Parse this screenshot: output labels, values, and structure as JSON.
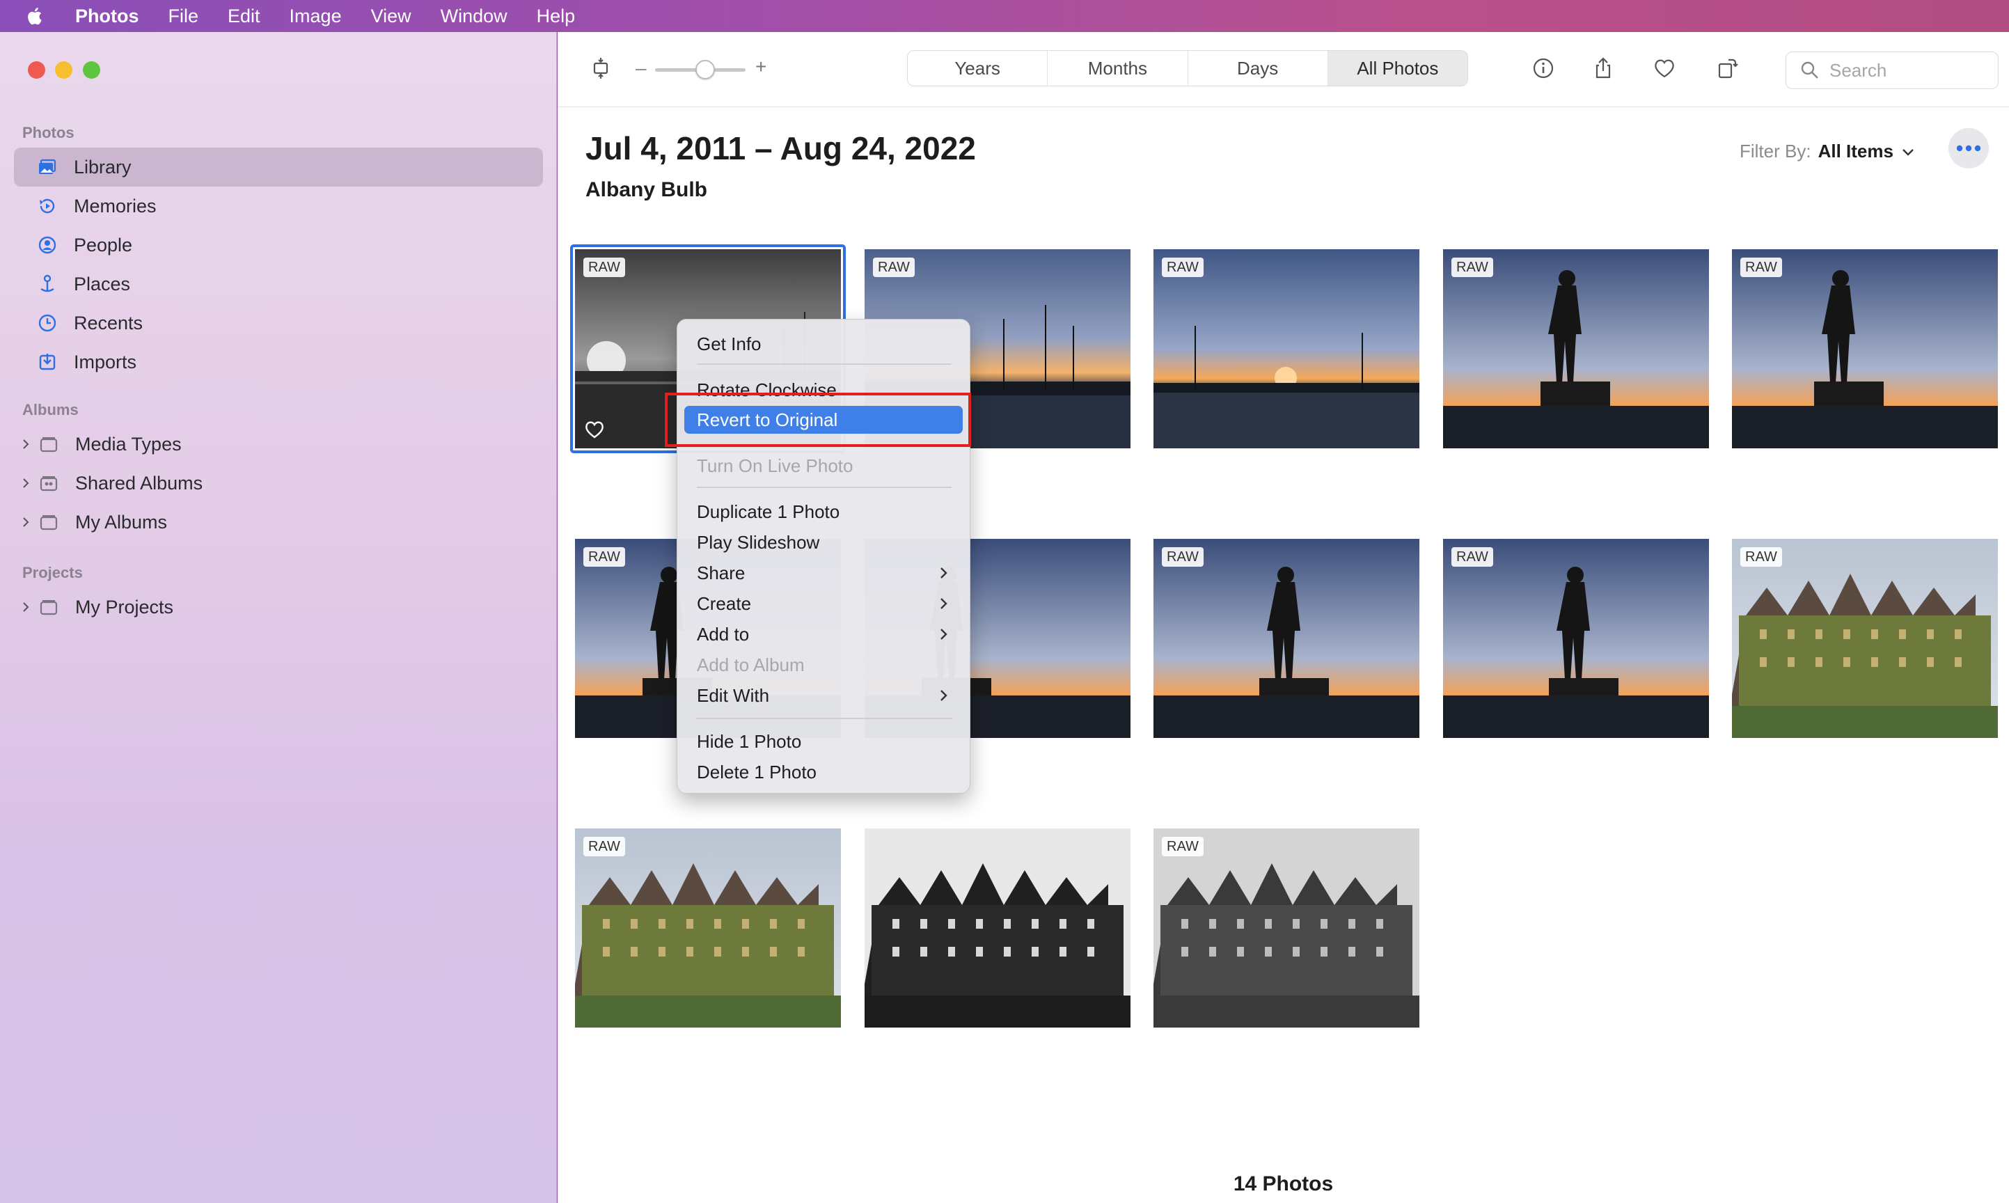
{
  "menubar": {
    "app": "Photos",
    "items": [
      "File",
      "Edit",
      "Image",
      "View",
      "Window",
      "Help"
    ]
  },
  "sidebar": {
    "sections": {
      "photos": "Photos",
      "albums": "Albums",
      "projects": "Projects"
    },
    "photos_items": [
      {
        "label": "Library",
        "icon": "library-icon",
        "selected": true
      },
      {
        "label": "Memories",
        "icon": "memories-icon"
      },
      {
        "label": "People",
        "icon": "people-icon"
      },
      {
        "label": "Places",
        "icon": "places-icon"
      },
      {
        "label": "Recents",
        "icon": "recents-icon"
      },
      {
        "label": "Imports",
        "icon": "imports-icon"
      }
    ],
    "album_items": [
      {
        "label": "Media Types",
        "icon": "folder-icon"
      },
      {
        "label": "Shared Albums",
        "icon": "shared-folder-icon"
      },
      {
        "label": "My Albums",
        "icon": "folder-icon"
      }
    ],
    "project_items": [
      {
        "label": "My Projects",
        "icon": "folder-icon"
      }
    ]
  },
  "toolbar": {
    "zoom_minus": "–",
    "zoom_plus": "+",
    "zoom_level": 0.55,
    "segments": [
      "Years",
      "Months",
      "Days",
      "All Photos"
    ],
    "active_segment": "All Photos",
    "search_placeholder": "Search"
  },
  "header": {
    "title": "Jul 4, 2011 – Aug 24, 2022",
    "subtitle": "Albany Bulb",
    "filter_label": "Filter By:",
    "filter_value": "All Items"
  },
  "photos": {
    "badge": "RAW",
    "count_label": "14 Photos",
    "tiles": [
      {
        "scene": "sunset-harbor-bw",
        "favorite": true,
        "selected": true
      },
      {
        "scene": "sunset-harbor"
      },
      {
        "scene": "sunset-harbor"
      },
      {
        "scene": "statue-silhouette"
      },
      {
        "scene": "statue-silhouette"
      },
      {
        "scene": "statue-silhouette"
      },
      {
        "scene": "statue-silhouette"
      },
      {
        "scene": "statue-silhouette"
      },
      {
        "scene": "statue-silhouette"
      },
      {
        "scene": "empress-hotel"
      },
      {
        "scene": "empress-hotel"
      },
      {
        "scene": "empress-hotel-bw"
      },
      {
        "scene": "empress-hotel-bw"
      }
    ]
  },
  "context_menu": {
    "items": [
      {
        "label": "Get Info"
      },
      {
        "label": "Rotate Clockwise"
      },
      {
        "label": "Revert to Original",
        "highlighted": true
      },
      {
        "label": "Turn On Live Photo",
        "disabled": true
      },
      {
        "label": "Duplicate 1 Photo"
      },
      {
        "label": "Play Slideshow"
      },
      {
        "label": "Share",
        "submenu": true
      },
      {
        "label": "Create",
        "submenu": true
      },
      {
        "label": "Add to",
        "submenu": true
      },
      {
        "label": "Add to Album",
        "disabled": true
      },
      {
        "label": "Edit With",
        "submenu": true
      },
      {
        "label": "Hide 1 Photo"
      },
      {
        "label": "Delete 1 Photo"
      }
    ]
  },
  "colors": {
    "accent": "#2f6fe4",
    "menu_highlight": "#3f7fe8",
    "annotation": "#e0201e"
  }
}
